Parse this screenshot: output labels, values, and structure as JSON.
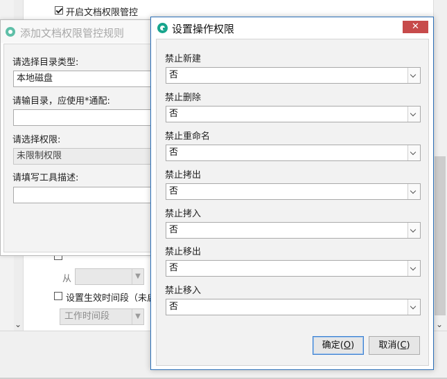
{
  "background": {
    "enable_checkbox_label": "开启文档权限管控",
    "enable_checked": true,
    "from_label": "从",
    "time_period_label": "设置生效时间段（未启",
    "time_period_checked": false,
    "worktime_select": "工作时间段"
  },
  "add_rule_dialog": {
    "title": "添加文档权限管控规则",
    "dir_type_label": "请选择目录类型:",
    "dir_type_value": "本地磁盘",
    "dir_input_label": "请输目录，应使用*通配:",
    "dir_input_value": "",
    "permission_label": "请选择权限:",
    "permission_value": "未限制权限",
    "desc_label": "请填写工具描述:",
    "desc_value": ""
  },
  "perm_dialog": {
    "title": "设置操作权限",
    "close_glyph": "✕",
    "items": [
      {
        "label": "禁止新建",
        "value": "否"
      },
      {
        "label": "禁止删除",
        "value": "否"
      },
      {
        "label": "禁止重命名",
        "value": "否"
      },
      {
        "label": "禁止拷出",
        "value": "否"
      },
      {
        "label": "禁止拷入",
        "value": "否"
      },
      {
        "label": "禁止移出",
        "value": "否"
      },
      {
        "label": "禁止移入",
        "value": "否"
      }
    ],
    "ok_text": "确定(",
    "ok_key": "O",
    "ok_end": ")",
    "cancel_text": "取消(",
    "cancel_key": "C",
    "cancel_end": ")"
  },
  "colors": {
    "accent_border": "#2a6fb8",
    "close_red": "#c74b4b",
    "logo_teal": "#18a58d"
  }
}
